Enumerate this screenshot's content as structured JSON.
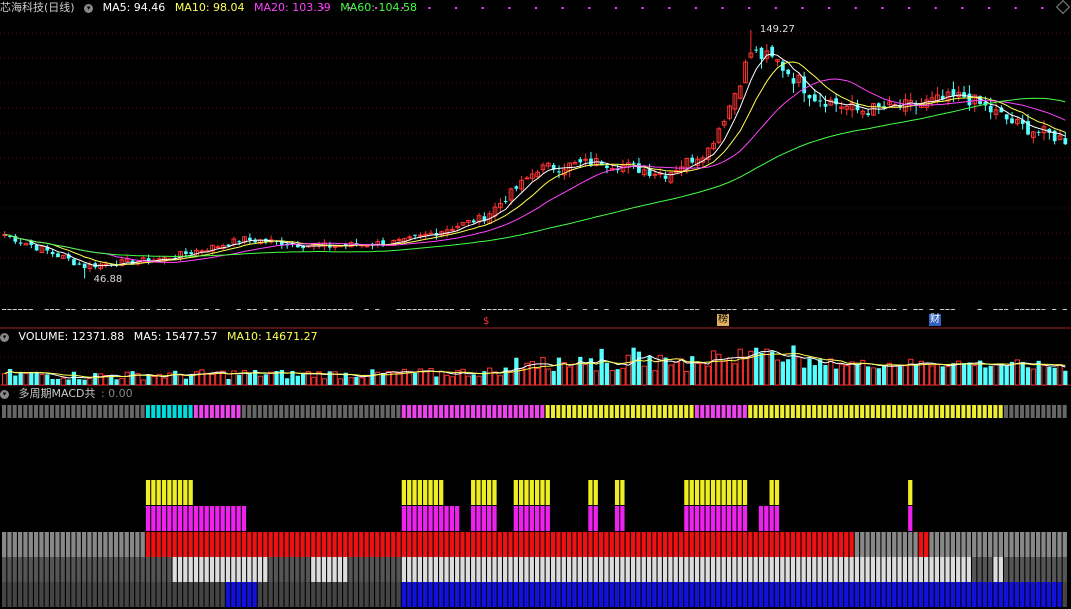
{
  "title": "芯海科技(日线)",
  "price_legend": [
    {
      "label": "MA5: 94.46",
      "color": "#ffffff"
    },
    {
      "label": "MA10: 98.04",
      "color": "#ffff55"
    },
    {
      "label": "MA20: 103.39",
      "color": "#ff44ff"
    },
    {
      "label": "MA60: 104.58",
      "color": "#44ff44"
    }
  ],
  "volume_legend": [
    {
      "label": "VOLUME: 12371.88",
      "color": "#ffffff"
    },
    {
      "label": "MA5: 15477.57",
      "color": "#ffffff"
    },
    {
      "label": "MA10: 14671.27",
      "color": "#ffff55"
    }
  ],
  "macd_title": "多周期MACD共",
  "macd_value": ": 0.00",
  "annotations": {
    "high": "149.27",
    "low": "46.88"
  },
  "event_marks": [
    {
      "text": "$",
      "color": "#ff3333",
      "bg": "#000000"
    },
    {
      "text": "榜",
      "color": "#000000",
      "bg": "#e0b060"
    },
    {
      "text": "财",
      "color": "#ffffff",
      "bg": "#3060c0"
    }
  ],
  "colors": {
    "up": "#ff3333",
    "down": "#55ffff",
    "ma5": "#ffffff",
    "ma10": "#ffff55",
    "ma20": "#ff44ff",
    "ma60": "#44ff44"
  },
  "chart_data": {
    "type": "candlestick",
    "price_range_visible": [
      46.88,
      149.27
    ],
    "ohlc_keypoints": [
      {
        "day": 0,
        "close": 65
      },
      {
        "day": 15,
        "close": 52
      },
      {
        "day": 30,
        "close": 55
      },
      {
        "day": 45,
        "close": 63
      },
      {
        "day": 60,
        "close": 60
      },
      {
        "day": 75,
        "close": 62
      },
      {
        "day": 90,
        "close": 72
      },
      {
        "day": 100,
        "close": 92
      },
      {
        "day": 112,
        "close": 95
      },
      {
        "day": 124,
        "close": 90
      },
      {
        "day": 132,
        "close": 100
      },
      {
        "day": 136,
        "close": 118
      },
      {
        "day": 140,
        "close": 140
      },
      {
        "day": 145,
        "close": 136
      },
      {
        "day": 152,
        "close": 122
      },
      {
        "day": 160,
        "close": 116
      },
      {
        "day": 170,
        "close": 118
      },
      {
        "day": 180,
        "close": 122
      },
      {
        "day": 190,
        "close": 110
      },
      {
        "day": 199,
        "close": 104
      }
    ],
    "high": 149.27,
    "low": 46.88,
    "ma_last": {
      "MA5": 94.46,
      "MA10": 98.04,
      "MA20": 103.39,
      "MA60": 104.58
    },
    "volume_last": 12371.88,
    "volume_ma": {
      "MA5": 15477.57,
      "MA10": 14671.27
    }
  }
}
